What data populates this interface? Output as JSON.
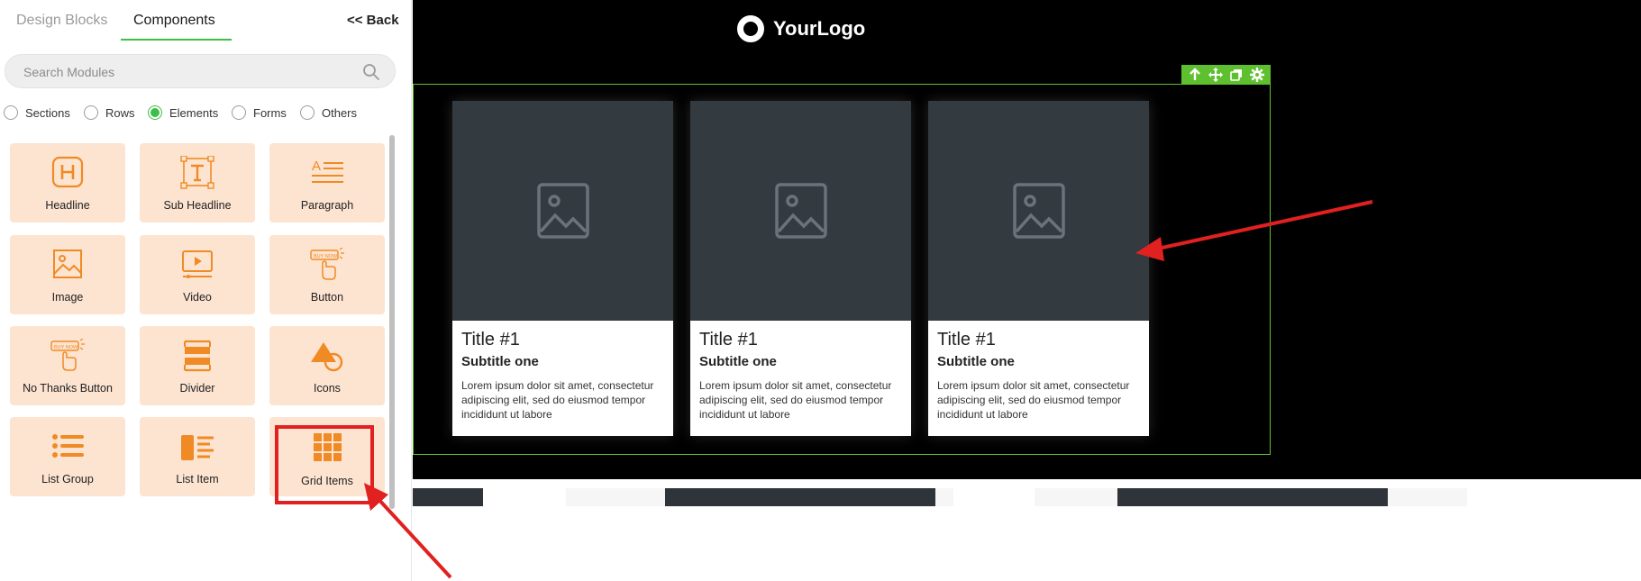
{
  "sidebar": {
    "tabs": [
      {
        "label": "Design Blocks"
      },
      {
        "label": "Components"
      }
    ],
    "back_label": "<< Back",
    "search": {
      "placeholder": "Search Modules",
      "value": ""
    },
    "filters": [
      {
        "label": "Sections",
        "checked": false
      },
      {
        "label": "Rows",
        "checked": false
      },
      {
        "label": "Elements",
        "checked": true
      },
      {
        "label": "Forms",
        "checked": false
      },
      {
        "label": "Others",
        "checked": false
      }
    ],
    "elements": [
      {
        "label": "Headline",
        "icon": "headline-icon"
      },
      {
        "label": "Sub Headline",
        "icon": "sub-headline-icon"
      },
      {
        "label": "Paragraph",
        "icon": "paragraph-icon"
      },
      {
        "label": "Image",
        "icon": "image-icon"
      },
      {
        "label": "Video",
        "icon": "video-icon"
      },
      {
        "label": "Button",
        "icon": "button-icon"
      },
      {
        "label": "No Thanks Button",
        "icon": "no-thanks-button-icon"
      },
      {
        "label": "Divider",
        "icon": "divider-icon"
      },
      {
        "label": "Icons",
        "icon": "shapes-icon"
      },
      {
        "label": "List Group",
        "icon": "list-group-icon"
      },
      {
        "label": "List Item",
        "icon": "list-item-icon"
      },
      {
        "label": "Grid Items",
        "icon": "grid-items-icon"
      }
    ],
    "icon_badge_text": "BUY NOW"
  },
  "canvas": {
    "logo_text": "YourLogo",
    "cards": [
      {
        "title": "Title #1",
        "subtitle": "Subtitle one",
        "desc": "Lorem ipsum dolor sit amet, consectetur adipiscing elit, sed do eiusmod tempor incididunt ut labore"
      },
      {
        "title": "Title #1",
        "subtitle": "Subtitle one",
        "desc": "Lorem ipsum dolor sit amet, consectetur adipiscing elit, sed do eiusmod tempor incididunt ut labore"
      },
      {
        "title": "Title #1",
        "subtitle": "Subtitle one",
        "desc": "Lorem ipsum dolor sit amet, consectetur adipiscing elit, sed do eiusmod tempor incididunt ut labore"
      }
    ],
    "toolbar_icons": [
      "arrow-up-icon",
      "move-icon",
      "duplicate-icon",
      "settings-icon"
    ]
  },
  "colors": {
    "accent_green": "#3cbf48",
    "toolbar_green": "#5fc02f",
    "tile_bg": "#fde4d1",
    "icon_orange": "#f08a24",
    "annotation_red": "#e12020"
  }
}
